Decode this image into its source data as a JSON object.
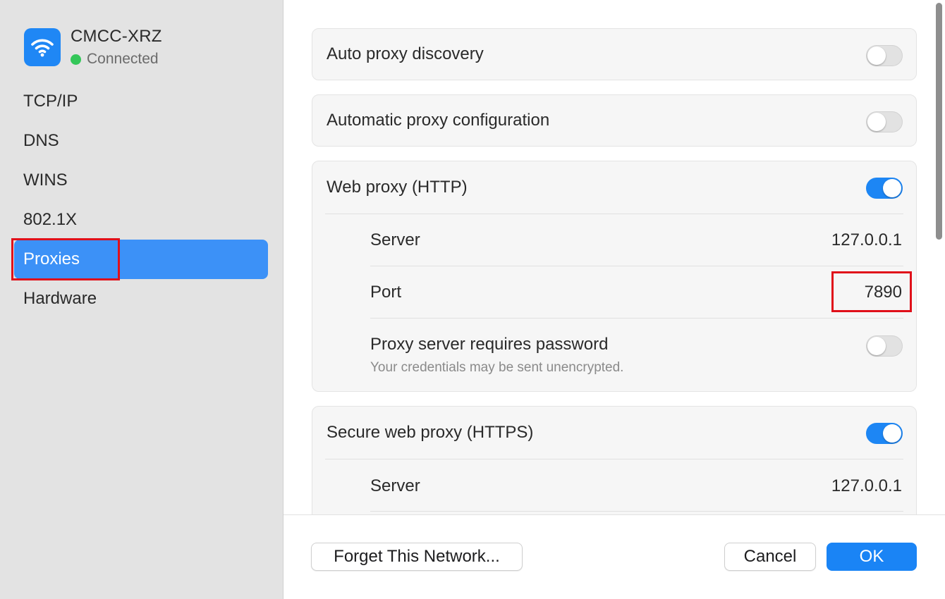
{
  "network": {
    "name": "CMCC-XRZ",
    "status": "Connected",
    "icon": "wifi-icon"
  },
  "sidebar": {
    "items": [
      {
        "label": "TCP/IP"
      },
      {
        "label": "DNS"
      },
      {
        "label": "WINS"
      },
      {
        "label": "802.1X"
      },
      {
        "label": "Proxies",
        "selected": true
      },
      {
        "label": "Hardware"
      }
    ]
  },
  "proxies": {
    "auto_discovery": {
      "label": "Auto proxy discovery",
      "enabled": false
    },
    "auto_config": {
      "label": "Automatic proxy configuration",
      "enabled": false
    },
    "web_http": {
      "label": "Web proxy (HTTP)",
      "enabled": true,
      "server_label": "Server",
      "server": "127.0.0.1",
      "port_label": "Port",
      "port": "7890",
      "password_label": "Proxy server requires password",
      "password_note": "Your credentials may be sent unencrypted.",
      "password_enabled": false
    },
    "secure_https": {
      "label": "Secure web proxy (HTTPS)",
      "enabled": true,
      "server_label": "Server",
      "server": "127.0.0.1"
    }
  },
  "footer": {
    "forget_label": "Forget This Network...",
    "cancel_label": "Cancel",
    "ok_label": "OK"
  },
  "colors": {
    "accent": "#1a84f5",
    "selection": "#3c91f7",
    "connected": "#34c759",
    "annotation": "#e0101a"
  }
}
